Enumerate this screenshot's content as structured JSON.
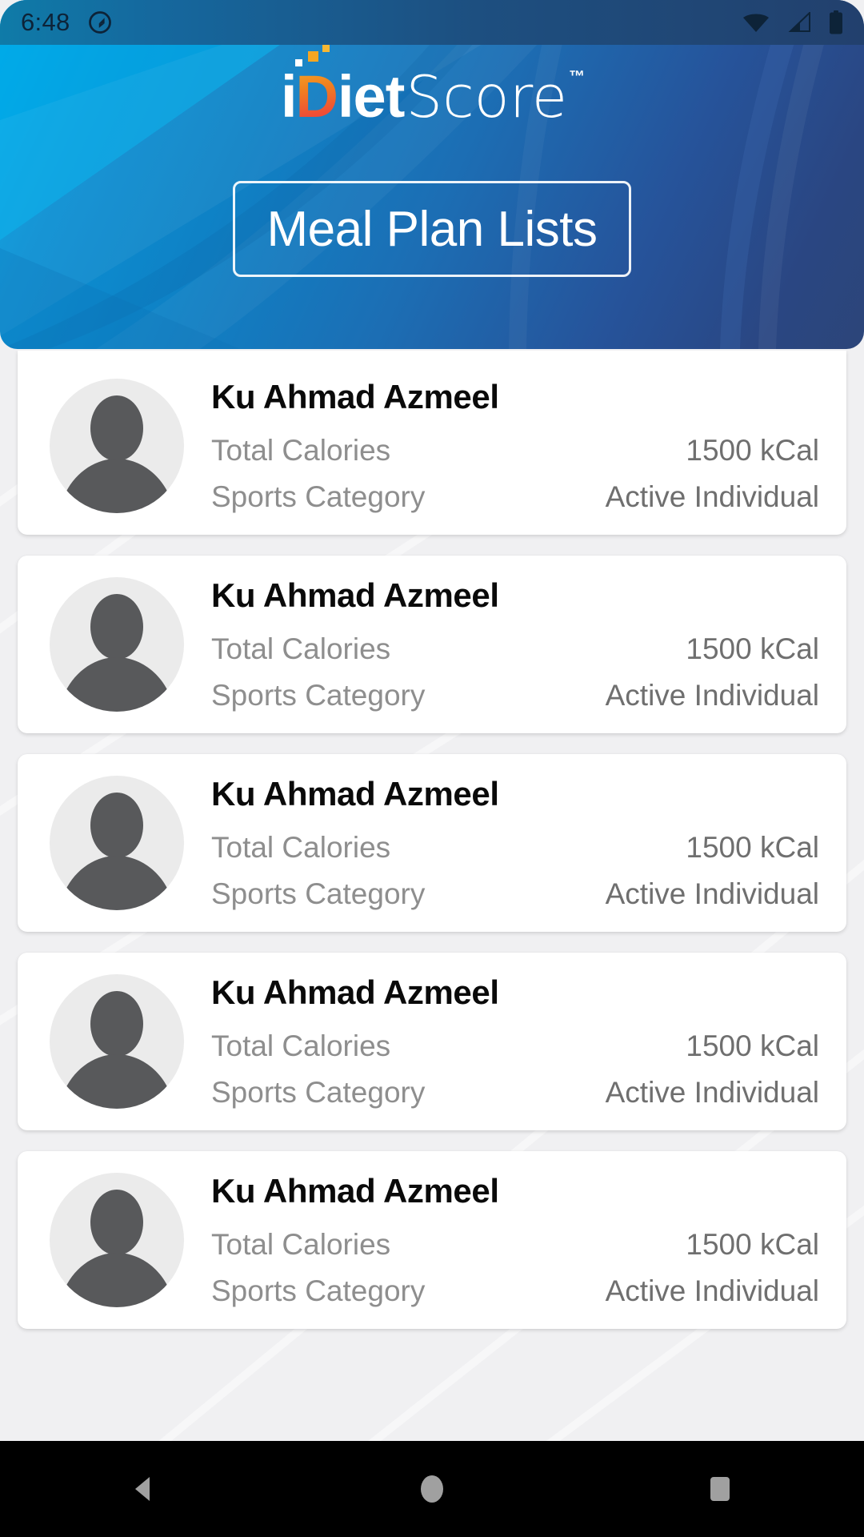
{
  "status_bar": {
    "time": "6:48",
    "icons": [
      "notification-circle-icon",
      "wifi-icon",
      "cellular-signal-icon",
      "battery-icon"
    ]
  },
  "header": {
    "logo": {
      "part_i": "i",
      "part_d": "D",
      "part_iet": "iet",
      "part_score": "Score",
      "trademark": "™"
    },
    "title": "Meal Plan Lists"
  },
  "colors": {
    "header_light_blue": "#00a6e6",
    "header_mid_blue": "#0e82c6",
    "header_dark_blue": "#2c4579",
    "logo_orange": "#f5a623",
    "logo_red": "#ee4036",
    "page_background": "#f0f0f2",
    "card_background": "#ffffff",
    "name_text": "#0a0a0a",
    "label_text": "#8e8e8e",
    "value_text": "#6f6f6f",
    "avatar_circle": "#ebebeb",
    "avatar_silhouette": "#58595b",
    "navbar_background": "#000000",
    "navbar_icon": "#a0a0a0"
  },
  "labels": {
    "total_calories": "Total Calories",
    "sports_category": "Sports Category"
  },
  "meal_plans": [
    {
      "name": "Ku Ahmad Azmeel",
      "total_calories": "1500 kCal",
      "sports_category": "Active Individual"
    },
    {
      "name": "Ku Ahmad Azmeel",
      "total_calories": "1500 kCal",
      "sports_category": "Active Individual"
    },
    {
      "name": "Ku Ahmad Azmeel",
      "total_calories": "1500 kCal",
      "sports_category": "Active Individual"
    },
    {
      "name": "Ku Ahmad Azmeel",
      "total_calories": "1500 kCal",
      "sports_category": "Active Individual"
    },
    {
      "name": "Ku Ahmad Azmeel",
      "total_calories": "1500 kCal",
      "sports_category": "Active Individual"
    }
  ],
  "navbar": {
    "back": "back-icon",
    "home": "home-icon",
    "recents": "recents-icon"
  }
}
